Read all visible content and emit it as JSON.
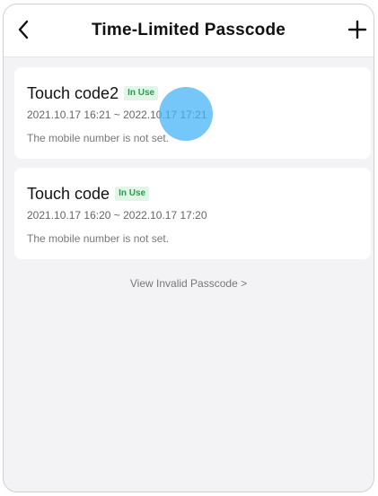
{
  "header": {
    "title": "Time-Limited Passcode"
  },
  "passcodes": [
    {
      "name": "Touch code2",
      "status": "In Use",
      "period": "2021.10.17 16:21 ~ 2022.10.17 17:21",
      "mobile_note": "The mobile number is not set."
    },
    {
      "name": "Touch code",
      "status": "In Use",
      "period": "2021.10.17 16:20 ~ 2022.10.17 17:20",
      "mobile_note": "The mobile number is not set."
    }
  ],
  "view_invalid_link": "View Invalid Passcode >",
  "colors": {
    "status_green": "#1aa64b",
    "status_bg": "#e2f6e8",
    "touch_indicator": "#46b4f5",
    "background": "#f3f3f5"
  },
  "icons": {
    "back": "chevron-left-icon",
    "add": "plus-icon"
  }
}
